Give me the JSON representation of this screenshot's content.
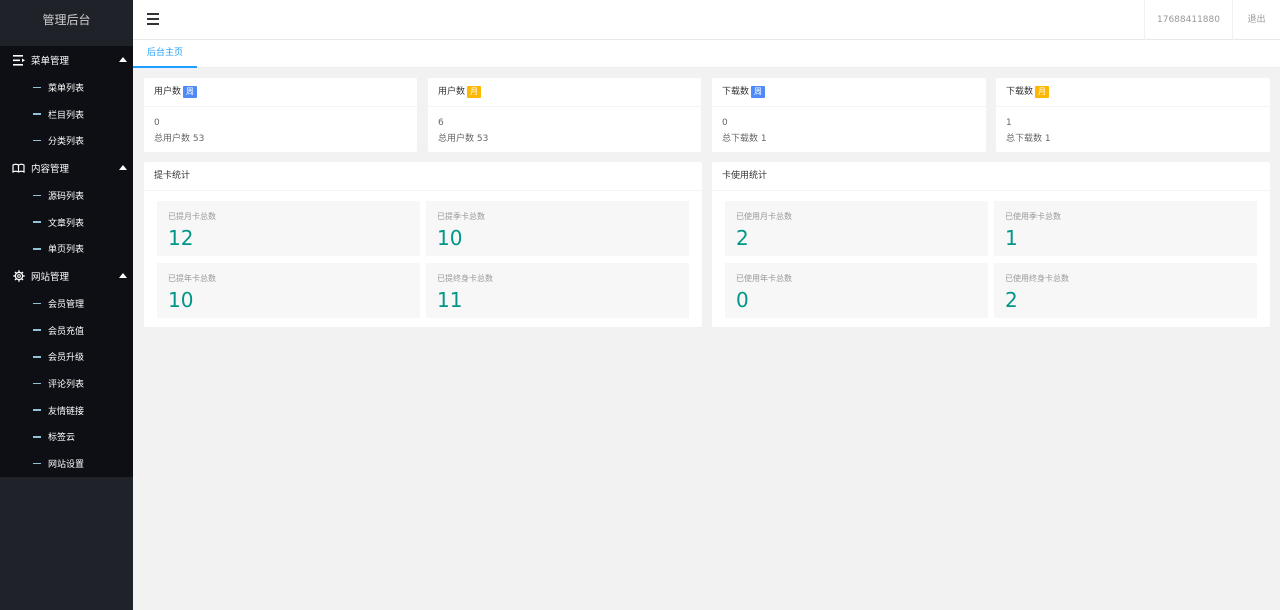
{
  "sidebar": {
    "title": "管理后台",
    "groups": [
      {
        "label": "菜单管理",
        "icon": "menu-list-icon",
        "items": [
          "菜单列表",
          "栏目列表",
          "分类列表"
        ]
      },
      {
        "label": "内容管理",
        "icon": "book-icon",
        "items": [
          "源码列表",
          "文章列表",
          "单页列表"
        ]
      },
      {
        "label": "网站管理",
        "icon": "gear-icon",
        "items": [
          "会员管理",
          "会员充值",
          "会员升级",
          "评论列表",
          "友情链接",
          "标签云",
          "网站设置"
        ]
      }
    ]
  },
  "header": {
    "phone": "17688411880",
    "logout": "退出"
  },
  "tabs": [
    "后台主页"
  ],
  "summary_cards": [
    {
      "title": "用户数",
      "badge": "周",
      "badge_color": "#4e8af9",
      "value": "0",
      "total": "总用户数 53"
    },
    {
      "title": "用户数",
      "badge": "月",
      "badge_color": "#ffb800",
      "value": "6",
      "total": "总用户数 53"
    },
    {
      "title": "下载数",
      "badge": "周",
      "badge_color": "#4e8af9",
      "value": "0",
      "total": "总下载数 1"
    },
    {
      "title": "下载数",
      "badge": "月",
      "badge_color": "#ffb800",
      "value": "1",
      "total": "总下载数 1"
    }
  ],
  "withdraw_stats": {
    "title": "提卡统计",
    "items": [
      {
        "label": "已提月卡总数",
        "value": "12"
      },
      {
        "label": "已提季卡总数",
        "value": "10"
      },
      {
        "label": "已提年卡总数",
        "value": "10"
      },
      {
        "label": "已提终身卡总数",
        "value": "11"
      }
    ]
  },
  "usage_stats": {
    "title": "卡使用统计",
    "items": [
      {
        "label": "已使用月卡总数",
        "value": "2"
      },
      {
        "label": "已使用季卡总数",
        "value": "1"
      },
      {
        "label": "已使用年卡总数",
        "value": "0"
      },
      {
        "label": "已使用终身卡总数",
        "value": "2"
      }
    ]
  },
  "colors": {
    "accent": "#1e9fff",
    "stat_value": "#009688",
    "sidebar_bg": "#20222a"
  }
}
